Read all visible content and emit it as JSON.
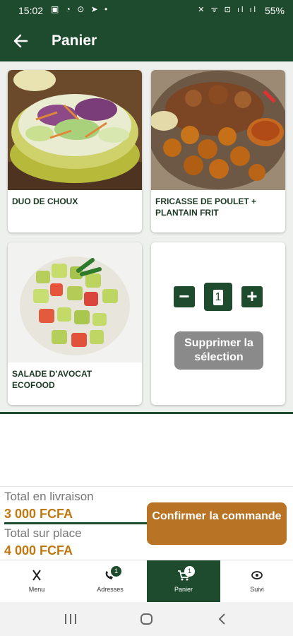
{
  "status_bar": {
    "time": "15:02",
    "notification_icons": "▣ ◔ ⊙ ➤ •",
    "system_icons": "✕ ᯤ ⊡ ıl ıl",
    "battery": "55%"
  },
  "app_bar": {
    "title": "Panier",
    "back_icon": "arrow-left-icon"
  },
  "products": [
    {
      "name": "DUO DE CHOUX"
    },
    {
      "name": "FRICASSE DE POULET + PLANTAIN FRIT"
    },
    {
      "name": "SALADE D'AVOCAT ECOFOOD"
    }
  ],
  "selection": {
    "quantity": "1",
    "minus": "−",
    "plus": "+",
    "delete_label": "Supprimer la sélection"
  },
  "totals": {
    "delivery_label": "Total en livraison",
    "delivery_value": "3 000 FCFA",
    "onsite_label": "Total sur place",
    "onsite_value": "4 000 FCFA",
    "confirm_label": "Confirmer la commande"
  },
  "bottom_nav": [
    {
      "label": "Menu",
      "icon": "fork-knife-icon"
    },
    {
      "label": "Adresses",
      "icon": "phone-icon",
      "badge": "1"
    },
    {
      "label": "Panier",
      "icon": "cart-icon",
      "badge": "1",
      "active": true
    },
    {
      "label": "Suivi",
      "icon": "eye-icon"
    }
  ],
  "colors": {
    "primary": "#1e4a2d",
    "accent": "#b87424",
    "price": "#c0780f",
    "disabled": "#8a8a8a"
  }
}
